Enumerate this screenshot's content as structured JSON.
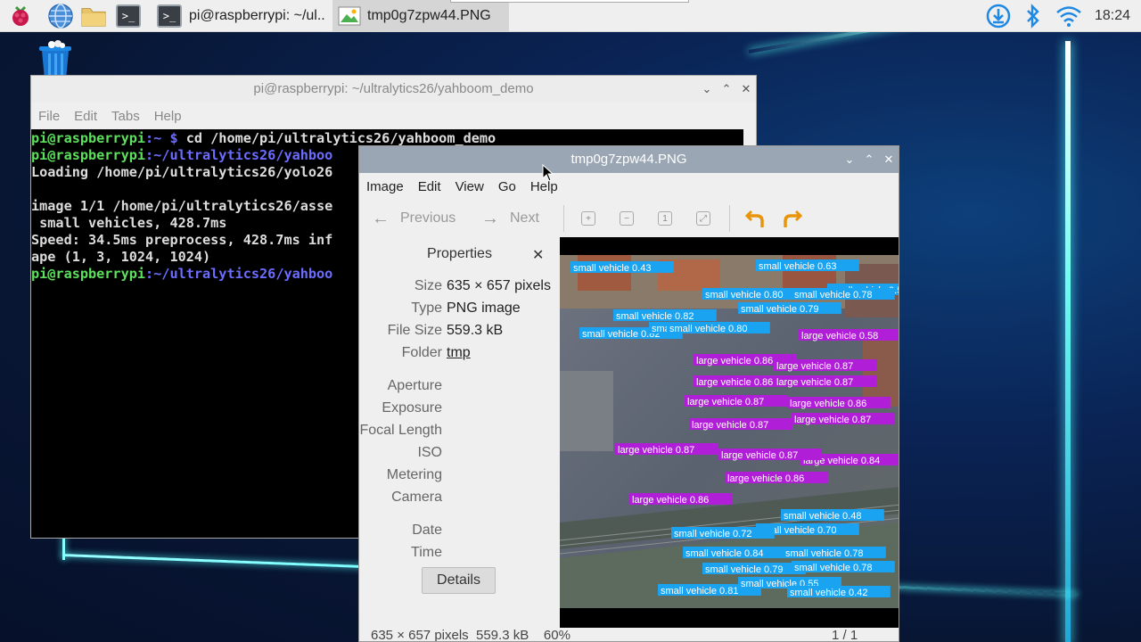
{
  "taskbar": {
    "windows": [
      {
        "label": "pi@raspberrypi: ~/ul..",
        "active": false
      },
      {
        "label": "tmp0g7zpw44.PNG",
        "active": true
      }
    ],
    "clock": "18:24"
  },
  "terminal": {
    "title": "pi@raspberrypi: ~/ultralytics26/yahboom_demo",
    "menu": [
      "File",
      "Edit",
      "Tabs",
      "Help"
    ],
    "lines": [
      {
        "user": "pi@raspberrypi",
        "path": ":~ $ ",
        "text": "cd /home/pi/ultralytics26/yahboom_demo"
      },
      {
        "user": "pi@raspberrypi",
        "path": ":~/ultralytics26/yahboo",
        "text": ""
      },
      {
        "user": "",
        "path": "",
        "text": "Loading /home/pi/ultralytics26/yolo26"
      },
      {
        "user": "",
        "path": "",
        "text": ""
      },
      {
        "user": "",
        "path": "",
        "text": "image 1/1 /home/pi/ultralytics26/asse"
      },
      {
        "user": "",
        "path": "",
        "text": " small vehicles, 428.7ms"
      },
      {
        "user": "",
        "path": "",
        "text": "Speed: 34.5ms preprocess, 428.7ms inf"
      },
      {
        "user": "",
        "path": "",
        "text": "ape (1, 3, 1024, 1024)"
      },
      {
        "user": "pi@raspberrypi",
        "path": ":~/ultralytics26/yahboo",
        "text": ""
      }
    ]
  },
  "viewer": {
    "title": "tmp0g7zpw44.PNG",
    "menu": [
      "Image",
      "Edit",
      "View",
      "Go",
      "Help"
    ],
    "toolbar": {
      "previous": "Previous",
      "next": "Next"
    },
    "properties": {
      "heading": "Properties",
      "rows": [
        {
          "label": "Size",
          "value": "635 × 657 pixels"
        },
        {
          "label": "Type",
          "value": "PNG image"
        },
        {
          "label": "File Size",
          "value": "559.3 kB"
        },
        {
          "label": "Folder",
          "value": "tmp"
        },
        {
          "label": "Aperture",
          "value": ""
        },
        {
          "label": "Exposure",
          "value": ""
        },
        {
          "label": "Focal Length",
          "value": ""
        },
        {
          "label": "ISO",
          "value": ""
        },
        {
          "label": "Metering",
          "value": ""
        },
        {
          "label": "Camera",
          "value": ""
        },
        {
          "label": "Date",
          "value": ""
        },
        {
          "label": "Time",
          "value": ""
        }
      ],
      "details_label": "Details"
    },
    "status": {
      "left": "635 × 657 pixels  559.3 kB    60%",
      "right": "1 / 1"
    },
    "detections": {
      "small": [
        "small vehicle 0.43",
        "small vehicle 0.63",
        "small vehicle 0.56",
        "small vehicle 0.80",
        "small vehicle 0.78",
        "small vehicle 0.79",
        "small vehicle 0.82",
        "small vehicle 0.84",
        "small vehicle 0.82",
        "small vehicle 0.80",
        "small vehicle 0.48",
        "small vehicle 0.70",
        "small vehicle 0.72",
        "small vehicle 0.84",
        "small vehicle 0.78",
        "small vehicle 0.79",
        "small vehicle 0.78",
        "small vehicle 0.81",
        "small vehicle 0.55",
        "small vehicle 0.42"
      ],
      "large": [
        "large vehicle 0.58",
        "large vehicle 0.86",
        "large vehicle 0.87",
        "large vehicle 0.86",
        "large vehicle 0.87",
        "large vehicle 0.87",
        "large vehicle 0.86",
        "large vehicle 0.87",
        "large vehicle 0.87",
        "large vehicle 0.84",
        "large vehicle 0.87",
        "large vehicle 0.87",
        "large vehicle 0.86",
        "large vehicle 0.86"
      ]
    }
  }
}
